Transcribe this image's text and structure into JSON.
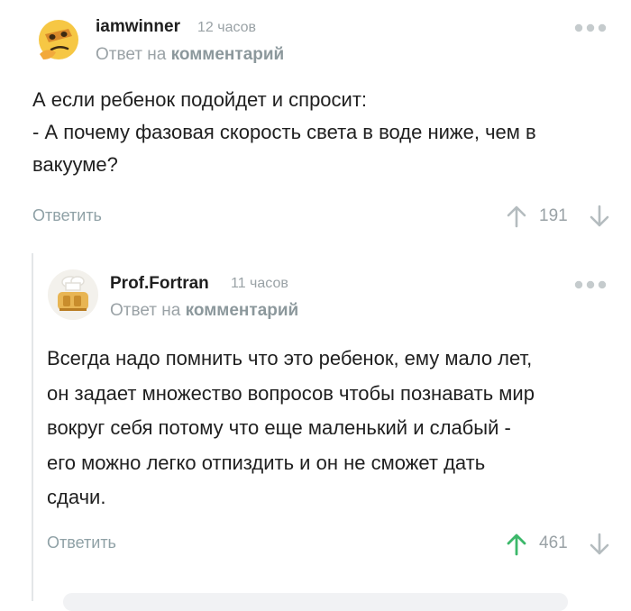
{
  "comments": [
    {
      "author": "iamwinner",
      "time": "12 часов",
      "reply_prefix": "Ответ на",
      "reply_link": "комментарий",
      "body_lines": [
        "А если ребенок подойдет и спросит:",
        "- А почему фазовая скорость света в воде ниже, чем в",
        "вакууме?"
      ],
      "answer_label": "Ответить",
      "score": "191",
      "upvoted": false,
      "avatar_icon": "thinking-face-icon"
    },
    {
      "author": "Prof.Fortran",
      "time": "11 часов",
      "reply_prefix": "Ответ на",
      "reply_link": "комментарий",
      "body_lines": [
        "Всегда надо помнить что это ребенок, ему мало лет,",
        "он задает множество вопросов чтобы познавать мир",
        "вокруг себя потому что еще маленький и слабый -",
        "его можно легко отпиздить и он не сможет дать",
        "сдачи."
      ],
      "answer_label": "Ответить",
      "score": "461",
      "upvoted": true,
      "avatar_icon": "toaster-chef-icon"
    }
  ],
  "colors": {
    "upvote_active": "#3cb86a",
    "muted": "#9aa2a6"
  }
}
